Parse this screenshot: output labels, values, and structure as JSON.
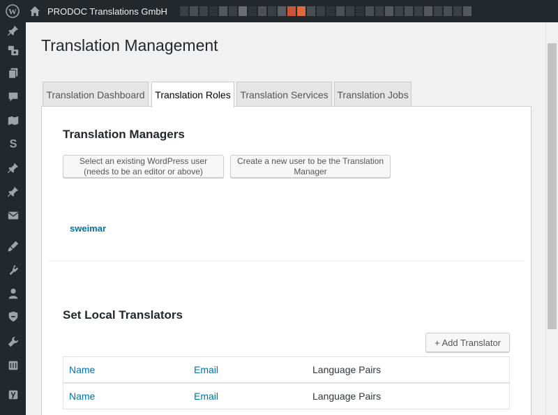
{
  "adminbar": {
    "site_name": "PRODOC Translations GmbH",
    "icons": [
      "wordpress-logo-icon",
      "home-icon"
    ],
    "blur_colors": [
      "#3a3f44",
      "#4a4f54",
      "#3e4348",
      "#2f3439",
      "#55595e",
      "#3a3f44",
      "#6a6e72",
      "#2f3439",
      "#4e5257",
      "#3a3f44",
      "#5a5e62",
      "#c8543a",
      "#e06a40",
      "#4a4f54",
      "#3a3f44",
      "#2f3439",
      "#4a4f54",
      "#3a3f44",
      "#2f3439",
      "#4a4f54",
      "#3a3f44",
      "#55595e",
      "#3e4348",
      "#4a4f54",
      "#3a3f44",
      "#55595e",
      "#3e4348",
      "#4a4f54",
      "#3a3f44",
      "#55595e"
    ]
  },
  "sidemenu": {
    "icons": [
      "pin-icon",
      "media-icon",
      "pages-icon",
      "comments-icon",
      "translation-icon",
      "s-logo-icon",
      "pin-icon",
      "pin-icon",
      "mail-icon",
      "brush-icon",
      "plugin-icon",
      "user-icon",
      "shield-icon",
      "wrench-icon",
      "settings-icon",
      "yoast-icon"
    ]
  },
  "page": {
    "title": "Translation Management"
  },
  "tabs": [
    {
      "label": "Translation Dashboard",
      "active": false
    },
    {
      "label": "Translation Roles",
      "active": true
    },
    {
      "label": "Translation Services",
      "active": false
    },
    {
      "label": "Translation Jobs",
      "active": false
    }
  ],
  "managers": {
    "title": "Translation Managers",
    "select_user_label": "Select an existing WordPress user (needs to be an editor or above)",
    "create_user_label": "Create a new user to be the Translation Manager",
    "manager_name": "sweimar"
  },
  "translators": {
    "title": "Set Local Translators",
    "add_button": "+ Add Translator",
    "columns": {
      "name": "Name",
      "email": "Email",
      "language_pairs": "Language Pairs"
    }
  },
  "colors": {
    "admin_bg": "#23282d",
    "link": "#0073aa",
    "page_bg": "#f1f1f1"
  }
}
